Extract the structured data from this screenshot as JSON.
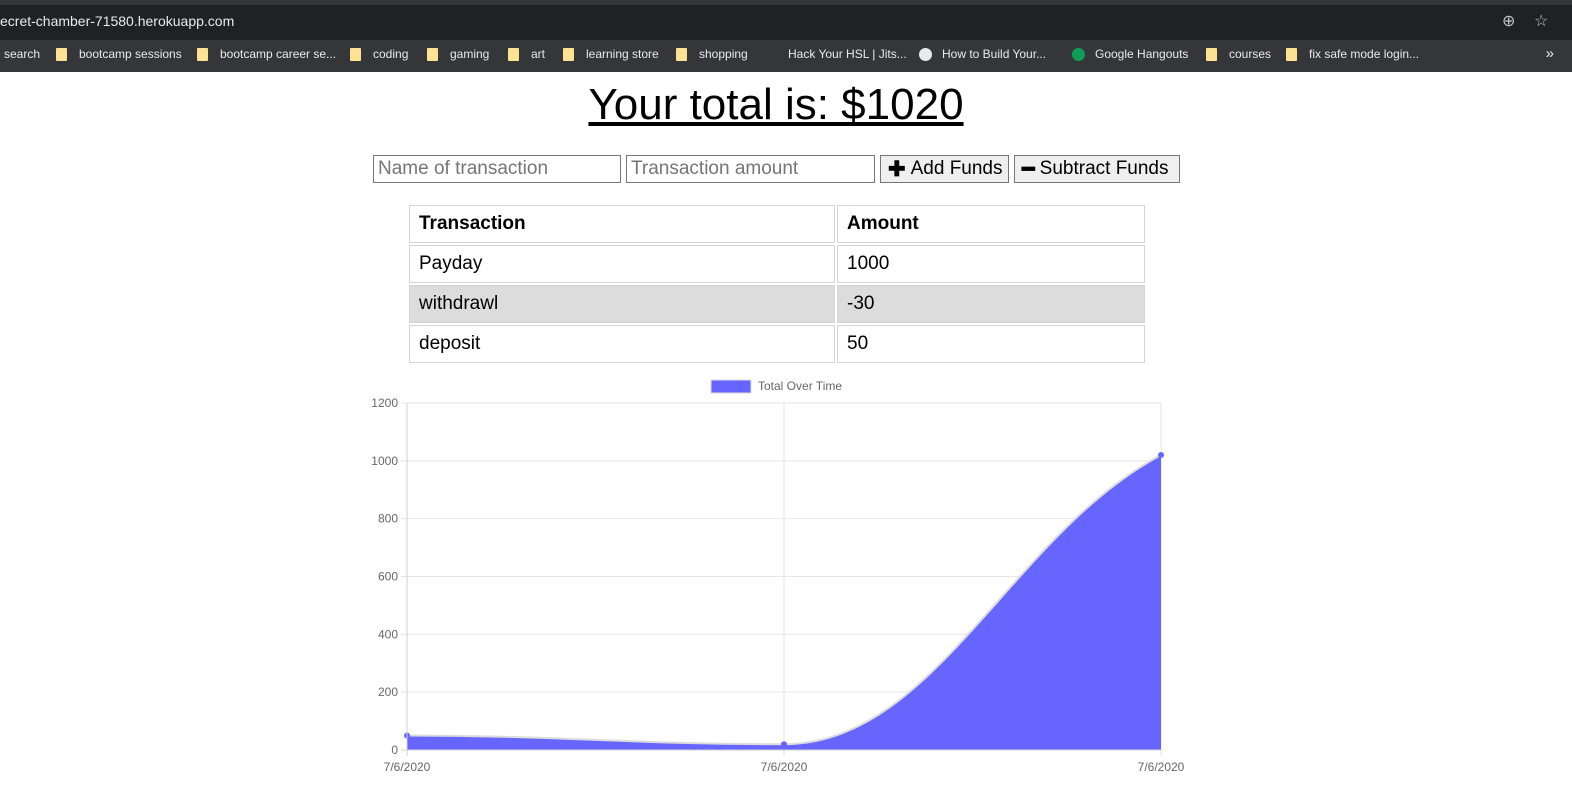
{
  "browser": {
    "url": "ecret-chamber-71580.herokuapp.com",
    "bookmarks": [
      {
        "label": "search",
        "icon": "search-icon"
      },
      {
        "label": "bootcamp sessions",
        "icon": "folder-icon"
      },
      {
        "label": "bootcamp career se...",
        "icon": "folder-icon"
      },
      {
        "label": "coding",
        "icon": "folder-icon"
      },
      {
        "label": "gaming",
        "icon": "folder-icon"
      },
      {
        "label": "art",
        "icon": "folder-icon"
      },
      {
        "label": "learning store",
        "icon": "folder-icon"
      },
      {
        "label": "shopping",
        "icon": "folder-icon"
      },
      {
        "label": "Hack Your HSL | Jits...",
        "icon": "page-icon"
      },
      {
        "label": "How to Build Your...",
        "icon": "globe-icon"
      },
      {
        "label": "Google Hangouts",
        "icon": "hangouts-icon"
      },
      {
        "label": "courses",
        "icon": "folder-icon"
      },
      {
        "label": "fix safe mode login...",
        "icon": "folder-icon"
      }
    ],
    "more_label": "»"
  },
  "page": {
    "total_text": "Your total is: $1020",
    "name_placeholder": "Name of transaction",
    "amount_placeholder": "Transaction amount",
    "add_label": "Add Funds",
    "subtract_label": "Subtract Funds",
    "table": {
      "headers": [
        "Transaction",
        "Amount"
      ],
      "rows": [
        {
          "name": "Payday",
          "amount": "1000"
        },
        {
          "name": "withdrawl",
          "amount": "-30"
        },
        {
          "name": "deposit",
          "amount": "50"
        }
      ]
    }
  },
  "chart_data": {
    "type": "area",
    "x": [
      "7/6/2020",
      "7/6/2020",
      "7/6/2020"
    ],
    "series": [
      {
        "name": "Total Over Time",
        "values": [
          50,
          20,
          1020
        ]
      }
    ],
    "ylim": [
      0,
      1200
    ],
    "yticks": [
      0,
      200,
      400,
      600,
      800,
      1000,
      1200
    ],
    "grid": true,
    "legend": "top",
    "colors": {
      "fill": "#6666ff",
      "line": "#dcdcdc",
      "point": "#6666ff"
    }
  }
}
